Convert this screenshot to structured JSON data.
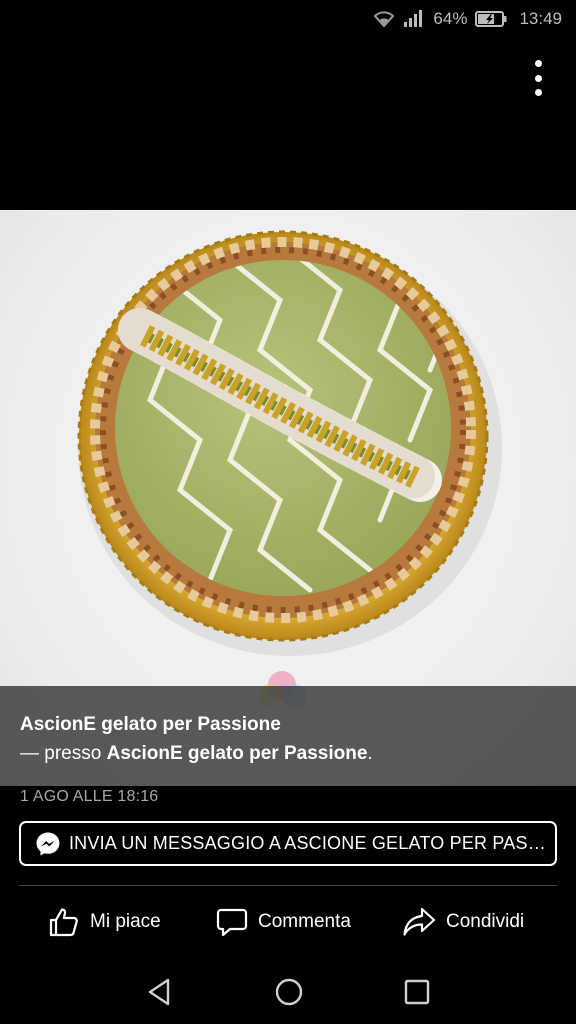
{
  "status_bar": {
    "battery_percent": "64%",
    "time": "13:49",
    "icons": [
      "wifi-icon",
      "signal-icon",
      "battery-charging-icon"
    ]
  },
  "post": {
    "page_name": "AscionE gelato per Passione",
    "location_prefix": " — presso ",
    "location_name": "AscionE gelato per Passione",
    "location_suffix": ".",
    "date": "1 AGO ALLE 18:16",
    "watermark_text": "AscionE"
  },
  "message_button": {
    "label": "INVIA UN MESSAGGIO A ASCIONE GELATO PER PASS...",
    "icon": "messenger-icon"
  },
  "actions": {
    "like_label": "Mi piace",
    "comment_label": "Commenta",
    "share_label": "Condividi"
  },
  "colors": {
    "background": "#000000",
    "caption_overlay": "#373737",
    "pistachio": "#a7b56a",
    "gold": "#d9a92b"
  }
}
